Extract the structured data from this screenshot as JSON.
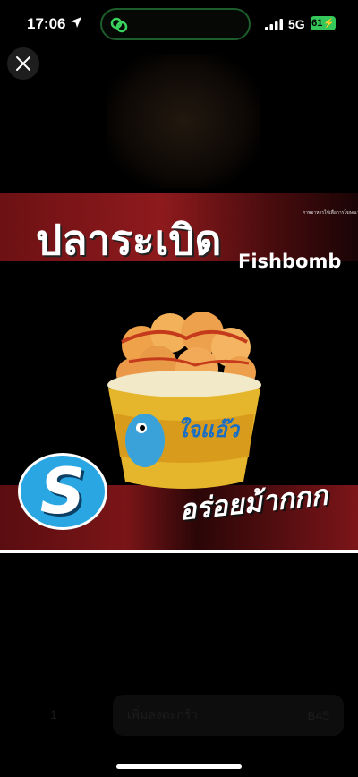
{
  "status_bar": {
    "time": "17:06",
    "network": "5G",
    "battery": "61"
  },
  "ad": {
    "small_text": "ภาพอาหารใช้เพื่อการโฆษณาเท่านั้น",
    "title_thai": "ปลาระเบิด",
    "title_en": "Fishbomb",
    "slogan": "อร่อยม้ากกก",
    "size_badge": "S",
    "cup_brand": "ใจแอ๊ว"
  },
  "order_bar": {
    "quantity": "1",
    "label": "เพิ่มลงตะกร้า",
    "price": "฿45"
  },
  "colors": {
    "red_band": "#8e1a1d",
    "badge_blue": "#2aa6e3",
    "battery_green": "#35c759"
  }
}
